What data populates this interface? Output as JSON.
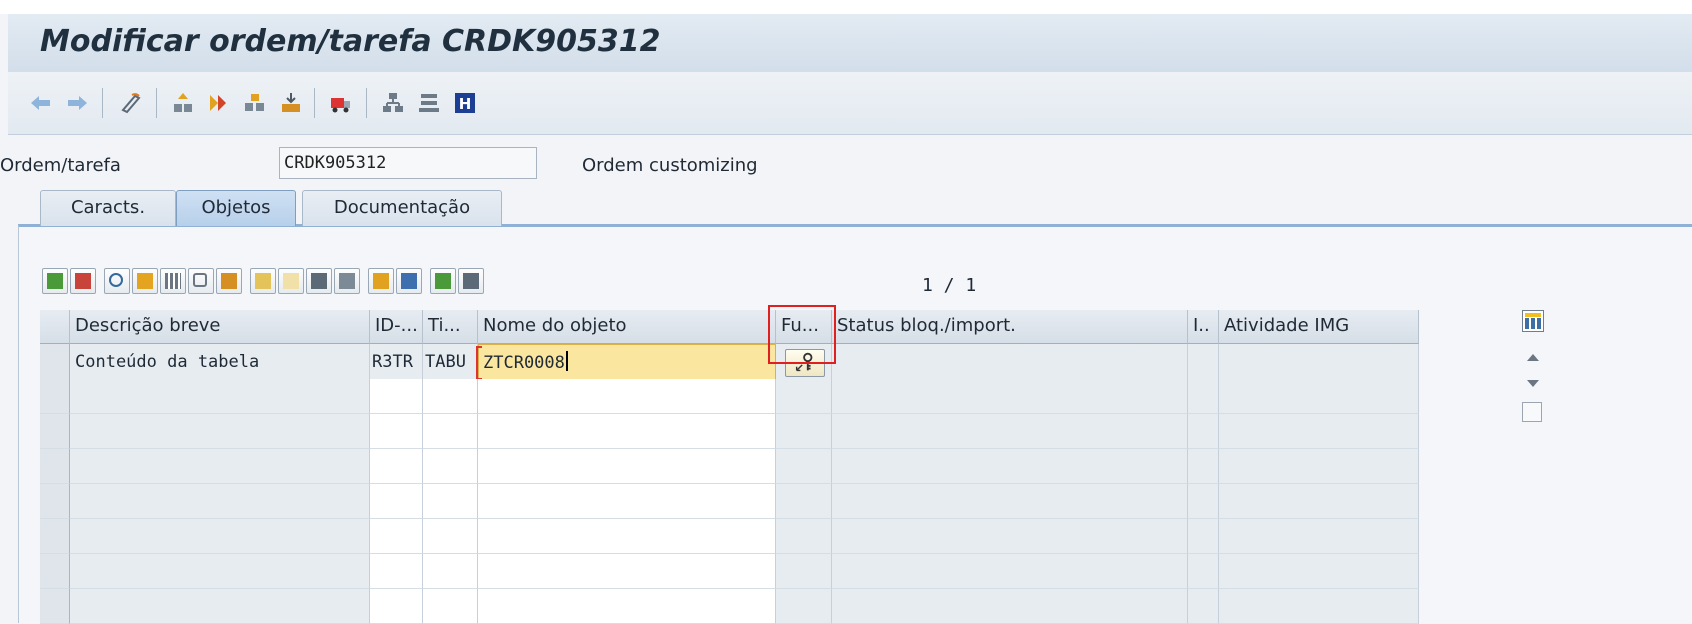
{
  "window": {
    "title": "Modificar ordem/tarefa CRDK905312"
  },
  "toolbar": {
    "icons": [
      "back-arrow-icon",
      "forward-arrow-icon",
      "display-change-icon",
      "hierarchy-up-icon",
      "double-arrow-icon",
      "objects-icon",
      "import-icon",
      "transport-truck-icon",
      "structure-icon",
      "list-icon",
      "info-icon"
    ]
  },
  "header": {
    "order_label": "Ordem/tarefa",
    "order_value": "CRDK905312",
    "order_type": "Ordem customizing"
  },
  "tabs": [
    {
      "label": "Caracts."
    },
    {
      "label": "Objetos",
      "active": true
    },
    {
      "label": "Documentação"
    }
  ],
  "grid": {
    "counter": "1 / 1",
    "columns": [
      "Descrição breve",
      "ID-...",
      "Ti...",
      "Nome do objeto",
      "Fu...",
      "Status bloq./import.",
      "I..",
      "Atividade IMG"
    ],
    "rows": [
      {
        "descricao": "Conteúdo da tabela",
        "id": "R3TR",
        "tipo": "TABU",
        "nome": "ZTCR0008",
        "status": "",
        "i": "",
        "atividade": ""
      }
    ]
  },
  "colors": {
    "title_bg": "#d8e3ee",
    "active_input": "#fbe6a0",
    "highlight_box": "#e02020"
  }
}
